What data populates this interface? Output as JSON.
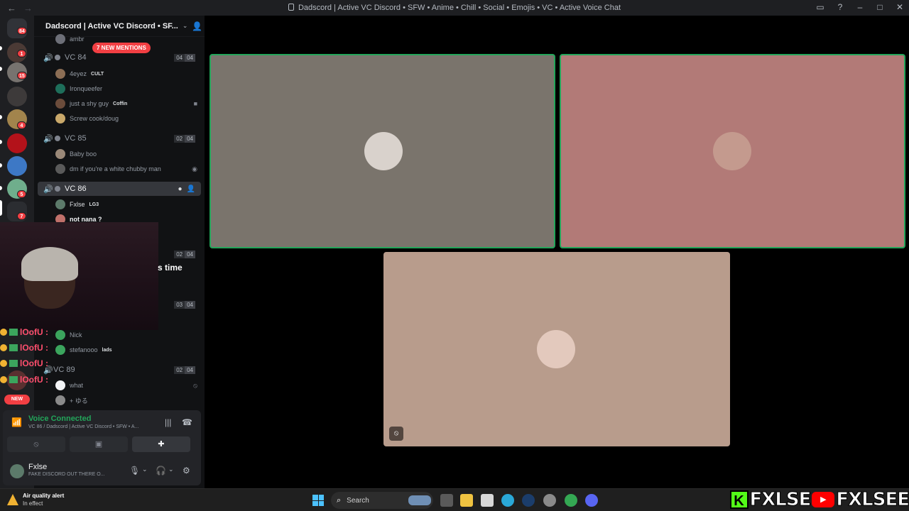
{
  "window": {
    "title": "Dadscord | Active VC Discord • SFW • Anime • Chill • Social • Emojis • VC • Active Voice Chat"
  },
  "rail": {
    "badges": [
      "84",
      "1",
      "15",
      "4",
      "5",
      "7"
    ],
    "new_label": "NEW"
  },
  "guild": {
    "name": "Dadscord | Active VC Discord • SF...",
    "new_mentions": "7 NEW MENTIONS",
    "top_member": "ambr"
  },
  "channels": [
    {
      "name": "VC 84",
      "count": [
        "04",
        "04"
      ],
      "members": [
        {
          "name": "4eyez",
          "tag": "CULT"
        },
        {
          "name": "Ironqueefer",
          "tag": ""
        },
        {
          "name": "just a shy guy",
          "tag": "Coffin"
        },
        {
          "name": "Screw cook/doug",
          "tag": ""
        }
      ]
    },
    {
      "name": "VC 85",
      "count": [
        "02",
        "04"
      ],
      "members": [
        {
          "name": "Baby boo",
          "tag": ""
        },
        {
          "name": "dm if you're a white chubby man",
          "tag": ""
        }
      ]
    },
    {
      "name": "VC 86",
      "count": [],
      "members": [
        {
          "name": "Fxlse",
          "tag": "LG3"
        },
        {
          "name": "not nana ?",
          "tag": ""
        }
      ]
    },
    {
      "name": "",
      "count": [
        "02",
        "04"
      ],
      "members": []
    },
    {
      "name": "",
      "count": [
        "03",
        "04"
      ],
      "members": [
        {
          "name": "Nick",
          "tag": ""
        },
        {
          "name": "stefanooo",
          "tag": "lads"
        }
      ]
    },
    {
      "name": "VC 89",
      "count": [
        "02",
        "04"
      ],
      "members": [
        {
          "name": "what",
          "tag": ""
        },
        {
          "name": "+ ゆる",
          "tag": ""
        }
      ]
    }
  ],
  "overlay": {
    "time_text": "s time",
    "chat_lines": [
      "lOofU :",
      "lOofU :",
      "lOofU :",
      "lOofU :"
    ]
  },
  "voice": {
    "status": "Voice Connected",
    "channel": "VC 86 / Dadscord | Active VC Discord • SFW • A..."
  },
  "user": {
    "name": "Fxlse",
    "status": "FAKE DISCORD OUT THERE O..."
  },
  "taskbar": {
    "weather_title": "Air quality alert",
    "weather_sub": "In effect",
    "search_placeholder": "Search"
  },
  "brand": {
    "kick_letter": "K",
    "kick_name": "FXLSE",
    "youtube_name": "FXLSEE"
  },
  "colors": {
    "speaking": "#23a55a",
    "tile1": "#7a746c",
    "tile2": "#b27a77",
    "tile3": "#b89c8c",
    "danger": "#f23f43"
  }
}
